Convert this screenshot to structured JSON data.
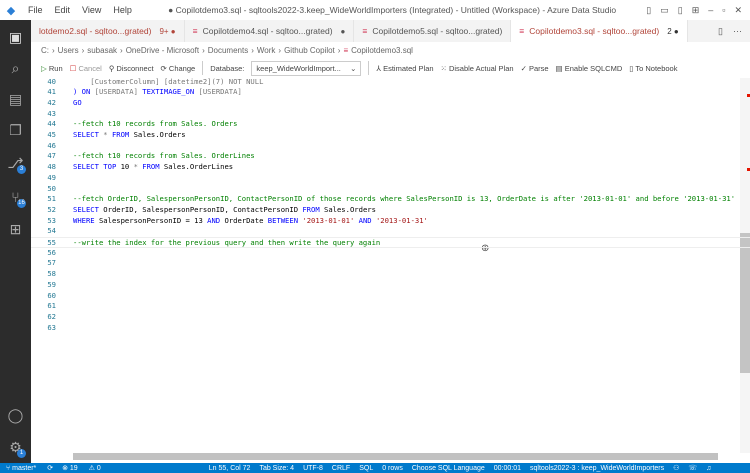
{
  "titlebar": {
    "menu": [
      "File",
      "Edit",
      "View",
      "Help"
    ],
    "title": "● Copilotdemo3.sql - sqltools2022-3.keep_WideWorldImporters (Integrated) - Untitled (Workspace) - Azure Data Studio"
  },
  "tabs": [
    {
      "label": "lotdemo2.sql - sqltoo...grated)",
      "suffix": "9+ ●"
    },
    {
      "label": "Copilotdemo4.sql - sqltoo...grated)",
      "suffix": "●"
    },
    {
      "label": "Copilotdemo5.sql - sqltoo...grated)",
      "suffix": ""
    },
    {
      "label": "Copilotdemo3.sql - sqltoo...grated)",
      "suffix": "2 ●"
    }
  ],
  "breadcrumb": [
    "C:",
    "Users",
    "subasak",
    "OneDrive - Microsoft",
    "Documents",
    "Work",
    "Github Copilot",
    "Copilotdemo3.sql"
  ],
  "toolbar": {
    "run": "Run",
    "cancel": "Cancel",
    "disconnect": "Disconnect",
    "change": "Change",
    "database_label": "Database:",
    "database": "keep_WideWorldImport...",
    "estimated_plan": "Estimated Plan",
    "disable_plan": "Disable Actual Plan",
    "parse": "Parse",
    "sqlcmd": "Enable SQLCMD",
    "notebook": "To Notebook"
  },
  "activity_badges": {
    "source_control": "3",
    "extensions": "16",
    "accounts": "1"
  },
  "lines": [
    {
      "n": "40",
      "t": [
        [
          "g",
          "    [CustomerColumn] [datetime2](7) NOT NULL"
        ]
      ]
    },
    {
      "n": "41",
      "t": [
        [
          "k",
          ") ON "
        ],
        [
          "g",
          "[USERDATA] "
        ],
        [
          "k",
          "TEXTIMAGE_ON "
        ],
        [
          "g",
          "[USERDATA]"
        ]
      ]
    },
    {
      "n": "42",
      "t": [
        [
          "k",
          "GO"
        ]
      ]
    },
    {
      "n": "43",
      "t": []
    },
    {
      "n": "44",
      "t": [
        [
          "c",
          "--fetch t10 records from Sales. Orders"
        ]
      ]
    },
    {
      "n": "45",
      "t": [
        [
          "k",
          "SELECT "
        ],
        [
          "g",
          "* "
        ],
        [
          "k",
          "FROM "
        ],
        [
          "p",
          "Sales.Orders"
        ]
      ]
    },
    {
      "n": "46",
      "t": []
    },
    {
      "n": "47",
      "t": [
        [
          "c",
          "--fetch t10 records from Sales. OrderLines"
        ]
      ]
    },
    {
      "n": "48",
      "t": [
        [
          "k",
          "SELECT TOP "
        ],
        [
          "p",
          "10 "
        ],
        [
          "g",
          "* "
        ],
        [
          "k",
          "FROM "
        ],
        [
          "p",
          "Sales.OrderLines"
        ]
      ]
    },
    {
      "n": "49",
      "t": []
    },
    {
      "n": "50",
      "t": []
    },
    {
      "n": "51",
      "t": [
        [
          "c",
          "--fetch OrderID, SalespersonPersonID, ContactPersonID of those records where SalesPersonID is 13, OrderDate is after '2013-01-01' and before '2013-01-31'"
        ]
      ]
    },
    {
      "n": "52",
      "t": [
        [
          "k",
          "SELECT "
        ],
        [
          "p",
          "OrderID, SalespersonPersonID, ContactPersonID "
        ],
        [
          "k",
          "FROM "
        ],
        [
          "p",
          "Sales.Orders"
        ]
      ]
    },
    {
      "n": "53",
      "t": [
        [
          "k",
          "WHERE "
        ],
        [
          "p",
          "SalespersonPersonID = 13 "
        ],
        [
          "k",
          "AND "
        ],
        [
          "p",
          "OrderDate "
        ],
        [
          "k",
          "BETWEEN "
        ],
        [
          "s",
          "'2013-01-01' "
        ],
        [
          "k",
          "AND "
        ],
        [
          "s",
          "'2013-01-31'"
        ]
      ]
    },
    {
      "n": "54",
      "t": []
    },
    {
      "n": "55",
      "t": [
        [
          "c",
          "--write the index for the previous query and then write the query again"
        ]
      ]
    },
    {
      "n": "56",
      "t": []
    },
    {
      "n": "57",
      "t": []
    },
    {
      "n": "58",
      "t": []
    },
    {
      "n": "59",
      "t": []
    },
    {
      "n": "60",
      "t": []
    },
    {
      "n": "61",
      "t": []
    },
    {
      "n": "62",
      "t": []
    },
    {
      "n": "63",
      "t": []
    }
  ],
  "status": {
    "branch": "master*",
    "errors": "⊗ 19",
    "warnings": "⚠ 0",
    "position": "Ln 55, Col 72",
    "tab": "Tab Size: 4",
    "encoding": "UTF-8",
    "eol": "CRLF",
    "lang": "SQL",
    "rows": "0 rows",
    "choose": "Choose SQL Language",
    "time": "00:00:01",
    "conn": "sqltools2022-3 : keep_WideWorldImporters"
  }
}
